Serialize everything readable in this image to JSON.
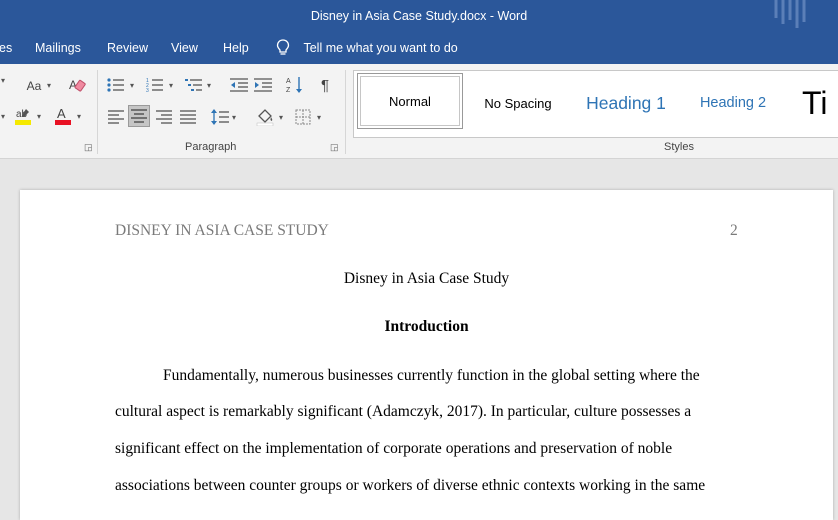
{
  "window": {
    "title": "Disney in Asia Case Study.docx  -  Word"
  },
  "tabs": [
    {
      "label": "es"
    },
    {
      "label": "Mailings"
    },
    {
      "label": "Review"
    },
    {
      "label": "View"
    },
    {
      "label": "Help"
    }
  ],
  "tell_me": {
    "label": "Tell me what you want to do",
    "icon": "lightbulb-icon"
  },
  "ribbon": {
    "font_group": {
      "change_case_label": "Aa"
    },
    "paragraph_group": {
      "label": "Paragraph"
    },
    "styles_group": {
      "label": "Styles",
      "items": [
        {
          "label": "Normal",
          "selected": true
        },
        {
          "label": "No Spacing"
        },
        {
          "label": "Heading 1"
        },
        {
          "label": "Heading 2"
        },
        {
          "label": "Ti"
        }
      ]
    },
    "colors": {
      "highlight": "#f5e900",
      "font_color": "#e81123",
      "heading": "#2e74b5"
    }
  },
  "document": {
    "header_text": "DISNEY IN ASIA CASE STUDY",
    "page_number": "2",
    "title": "Disney in Asia Case Study",
    "section_heading": "Introduction",
    "paragraph_lines": [
      "Fundamentally, numerous businesses currently function in the global setting where the",
      "cultural aspect is remarkably significant (Adamczyk, 2017). In particular, culture possesses a",
      "significant effect on the implementation of corporate operations and preservation of noble",
      "associations between counter groups or workers of diverse ethnic contexts working in the same"
    ]
  }
}
